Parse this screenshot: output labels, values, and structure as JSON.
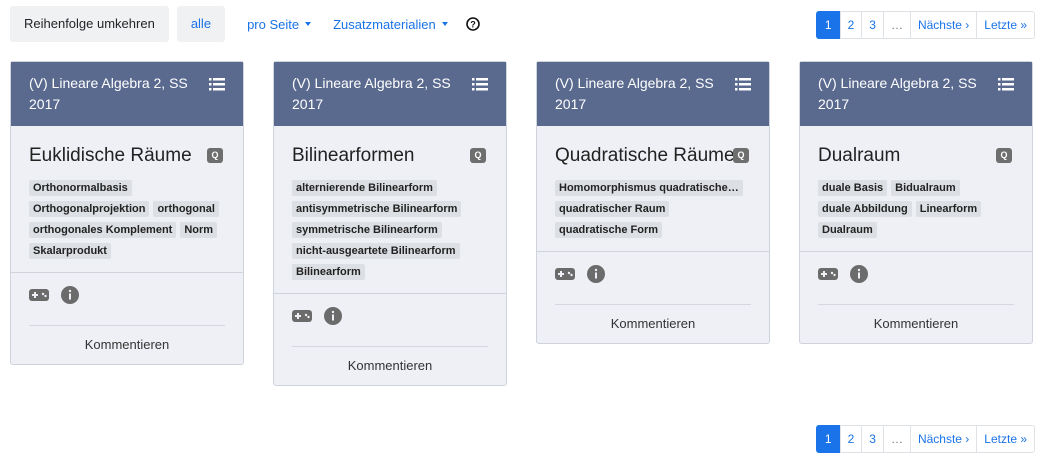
{
  "toolbar": {
    "reverse_label": "Reihenfolge umkehren",
    "all_label": "alle",
    "per_page_label": "pro Seite",
    "materials_label": "Zusatzmaterialien"
  },
  "pagination": {
    "pages": [
      "1",
      "2",
      "3",
      "…"
    ],
    "next_label": "Nächste ›",
    "last_label": "Letzte »"
  },
  "cards": [
    {
      "course": "(V) Lineare Algebra 2, SS 2017",
      "title": "Euklidische Räume",
      "tags": [
        "Orthonormalbasis",
        "Orthogonalprojektion",
        "orthogonal",
        "orthogonales Komplement",
        "Norm",
        "Skalarprodukt"
      ],
      "comment_label": "Kommentieren"
    },
    {
      "course": "(V) Lineare Algebra 2, SS 2017",
      "title": "Bilinearformen",
      "tags": [
        "alternierende Bilinearform",
        "antisymmetrische Bilinearform",
        "symmetrische Bilinearform",
        "nicht-ausgeartete Bilinearform",
        "Bilinearform"
      ],
      "comment_label": "Kommentieren"
    },
    {
      "course": "(V) Lineare Algebra 2, SS 2017",
      "title": "Quadratische Räume",
      "tags": [
        "Homomorphismus quadratische…",
        "quadratischer Raum",
        "quadratische Form"
      ],
      "comment_label": "Kommentieren"
    },
    {
      "course": "(V) Lineare Algebra 2, SS 2017",
      "title": "Dualraum",
      "tags": [
        "duale Basis",
        "Bidualraum",
        "duale Abbildung",
        "Linearform",
        "Dualraum"
      ],
      "comment_label": "Kommentieren"
    }
  ],
  "colors": {
    "accent": "#1a73e8",
    "card_header": "#5a6a8f",
    "card_body": "#eef0f6"
  },
  "icons": [
    "help-icon",
    "list-icon",
    "search-badge-icon",
    "gamepad-icon",
    "info-icon"
  ]
}
